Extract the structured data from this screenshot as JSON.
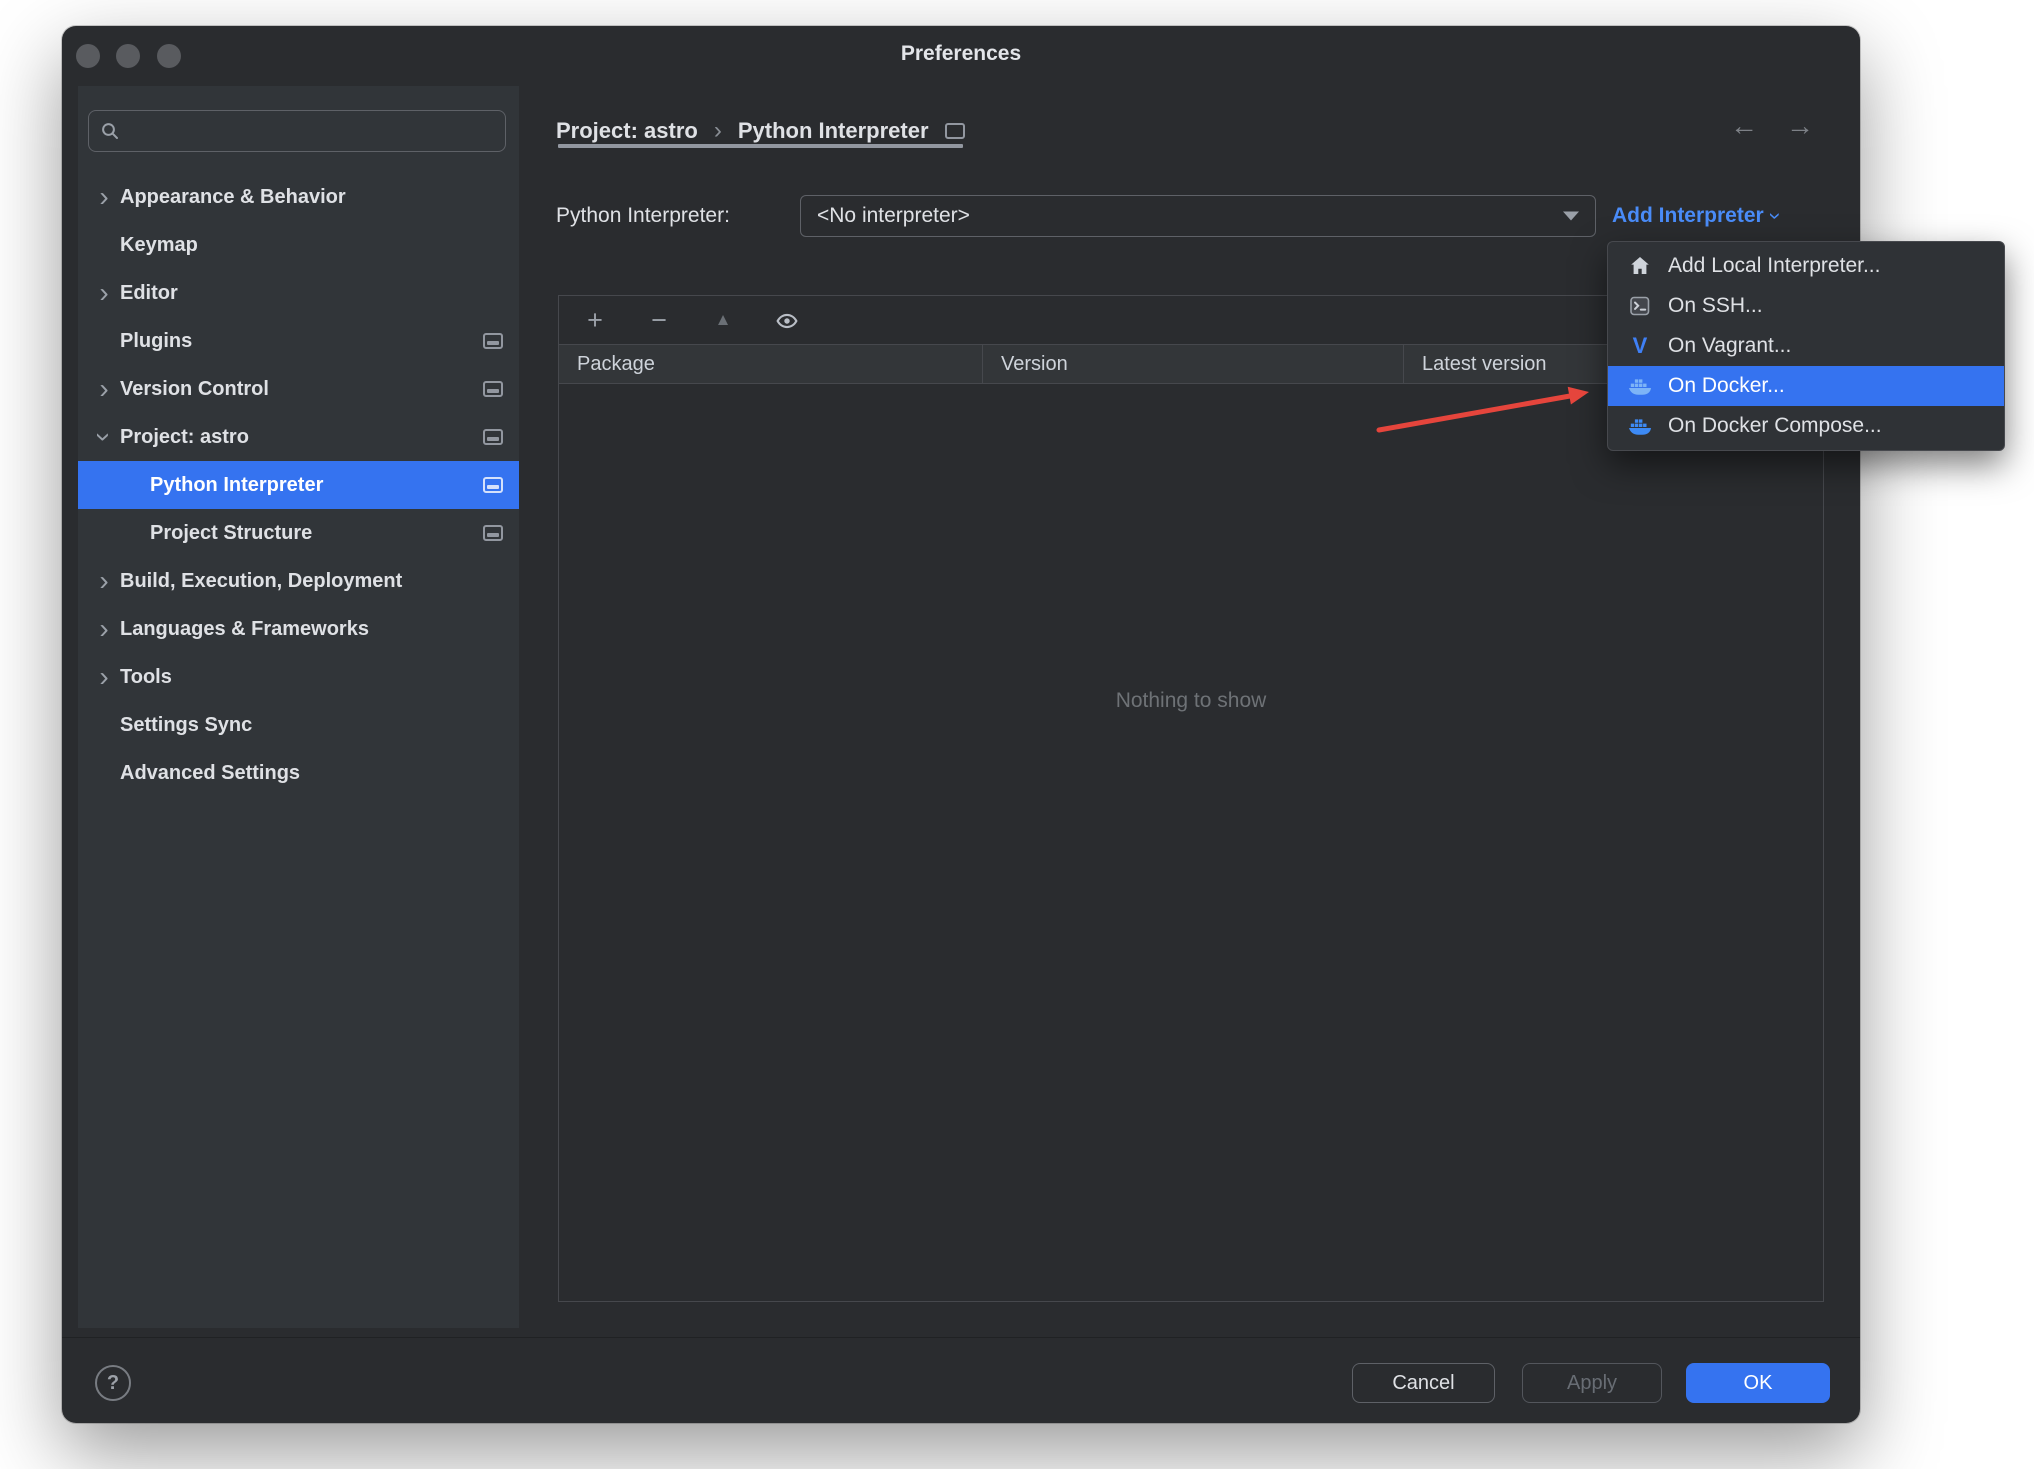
{
  "window": {
    "title": "Preferences"
  },
  "sidebar": {
    "search_placeholder": "",
    "items": [
      {
        "label": "Appearance & Behavior"
      },
      {
        "label": "Keymap"
      },
      {
        "label": "Editor"
      },
      {
        "label": "Plugins"
      },
      {
        "label": "Version Control"
      },
      {
        "label": "Project: astro"
      },
      {
        "label": "Python Interpreter"
      },
      {
        "label": "Project Structure"
      },
      {
        "label": "Build, Execution, Deployment"
      },
      {
        "label": "Languages & Frameworks"
      },
      {
        "label": "Tools"
      },
      {
        "label": "Settings Sync"
      },
      {
        "label": "Advanced Settings"
      }
    ]
  },
  "header": {
    "breadcrumb": {
      "project": "Project: astro",
      "separator": "›",
      "page": "Python Interpreter"
    }
  },
  "interpreter_row": {
    "label": "Python Interpreter:",
    "selected_value": "<No interpreter>",
    "add_link": "Add Interpreter"
  },
  "add_menu": {
    "items": [
      {
        "label": "Add Local Interpreter...",
        "icon": "home-icon"
      },
      {
        "label": "On SSH...",
        "icon": "terminal-icon"
      },
      {
        "label": "On Vagrant...",
        "icon": "vagrant-icon"
      },
      {
        "label": "On Docker...",
        "icon": "docker-icon"
      },
      {
        "label": "On Docker Compose...",
        "icon": "docker-icon"
      }
    ]
  },
  "package_table": {
    "columns": [
      "Package",
      "Version",
      "Latest version"
    ],
    "empty_text": "Nothing to show"
  },
  "footer": {
    "cancel": "Cancel",
    "apply": "Apply",
    "ok": "OK"
  },
  "icons": {
    "back": "←",
    "forward": "→",
    "add": "+",
    "remove": "−",
    "move_up": "▲",
    "help": "?"
  },
  "colors": {
    "accent": "#3573f0",
    "link": "#4a8cf8",
    "annotation_arrow": "#e5453c",
    "selection": "#3573f0"
  }
}
